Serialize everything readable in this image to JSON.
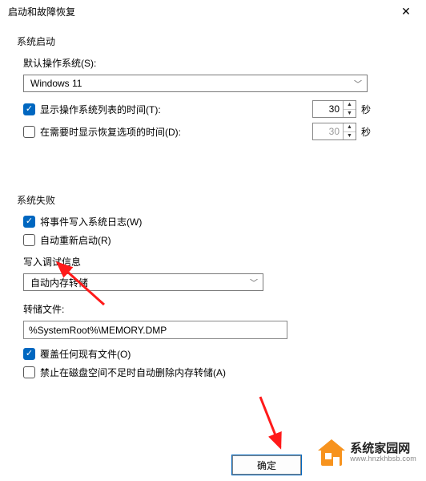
{
  "dialog": {
    "title": "启动和故障恢复",
    "close": "✕"
  },
  "sections": {
    "startup": {
      "title": "系统启动",
      "default_os_label": "默认操作系统(S):",
      "default_os_value": "Windows 11",
      "show_os_list": {
        "label": "显示操作系统列表的时间(T):",
        "checked": true,
        "value": "30",
        "unit": "秒"
      },
      "show_recovery": {
        "label": "在需要时显示恢复选项的时间(D):",
        "checked": false,
        "value": "30",
        "unit": "秒"
      }
    },
    "failure": {
      "title": "系统失败",
      "write_event": {
        "label": "将事件写入系统日志(W)",
        "checked": true
      },
      "auto_restart": {
        "label": "自动重新启动(R)",
        "checked": false
      },
      "debug_info_label": "写入调试信息",
      "dump_type": "自动内存转储",
      "dump_file_label": "转储文件:",
      "dump_file_value": "%SystemRoot%\\MEMORY.DMP",
      "overwrite": {
        "label": "覆盖任何现有文件(O)",
        "checked": true
      },
      "low_disk": {
        "label": "禁止在磁盘空间不足时自动删除内存转储(A)",
        "checked": false
      }
    }
  },
  "buttons": {
    "ok": "确定"
  },
  "watermark": {
    "line1": "系统家园网",
    "line2": "www.hnzkhbsb.com"
  }
}
